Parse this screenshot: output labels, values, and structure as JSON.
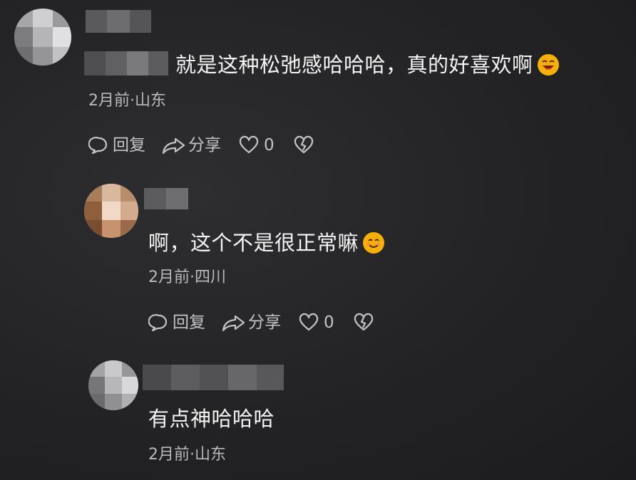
{
  "comments": [
    {
      "text": "就是这种松弛感哈哈哈，真的好喜欢啊",
      "meta": "2月前·山东",
      "reply_label": "回复",
      "share_label": "分享",
      "like_count": "0",
      "emoji": "laughing-emoji"
    },
    {
      "text": "啊，这个不是很正常嘛",
      "meta": "2月前·四川",
      "reply_label": "回复",
      "share_label": "分享",
      "like_count": "0",
      "emoji": "smiling-emoji"
    },
    {
      "text": "有点神哈哈哈",
      "meta": "2月前·山东"
    }
  ],
  "colors": {
    "background": "#232325",
    "text": "#f4f4f4",
    "meta": "#b9b9bb",
    "icon": "#c4c4c6",
    "emoji": "#f5b400"
  }
}
